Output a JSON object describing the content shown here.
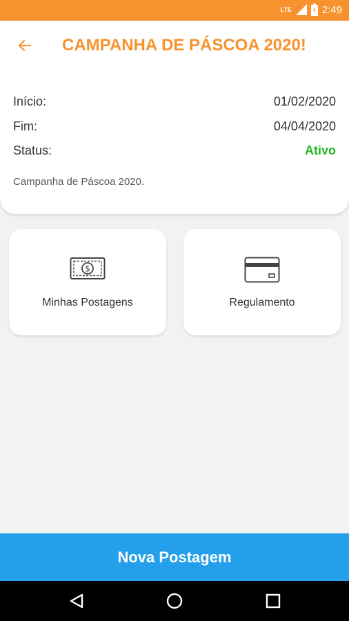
{
  "status_bar": {
    "network": "LTE",
    "time": "2:49"
  },
  "header": {
    "title": "CAMPANHA DE PÁSCOA 2020!"
  },
  "details": {
    "start_label": "Início:",
    "start_value": "01/02/2020",
    "end_label": "Fim:",
    "end_value": "04/04/2020",
    "status_label": "Status:",
    "status_value": "Ativo",
    "description": "Campanha de Páscoa 2020."
  },
  "tiles": [
    {
      "label": "Minhas Postagens",
      "icon": "money-bill-icon"
    },
    {
      "label": "Regulamento",
      "icon": "card-icon"
    }
  ],
  "primary_button": {
    "label": "Nova Postagem"
  },
  "colors": {
    "accent": "#f7922f",
    "primary": "#23a0e9",
    "status_active": "#22b522"
  }
}
